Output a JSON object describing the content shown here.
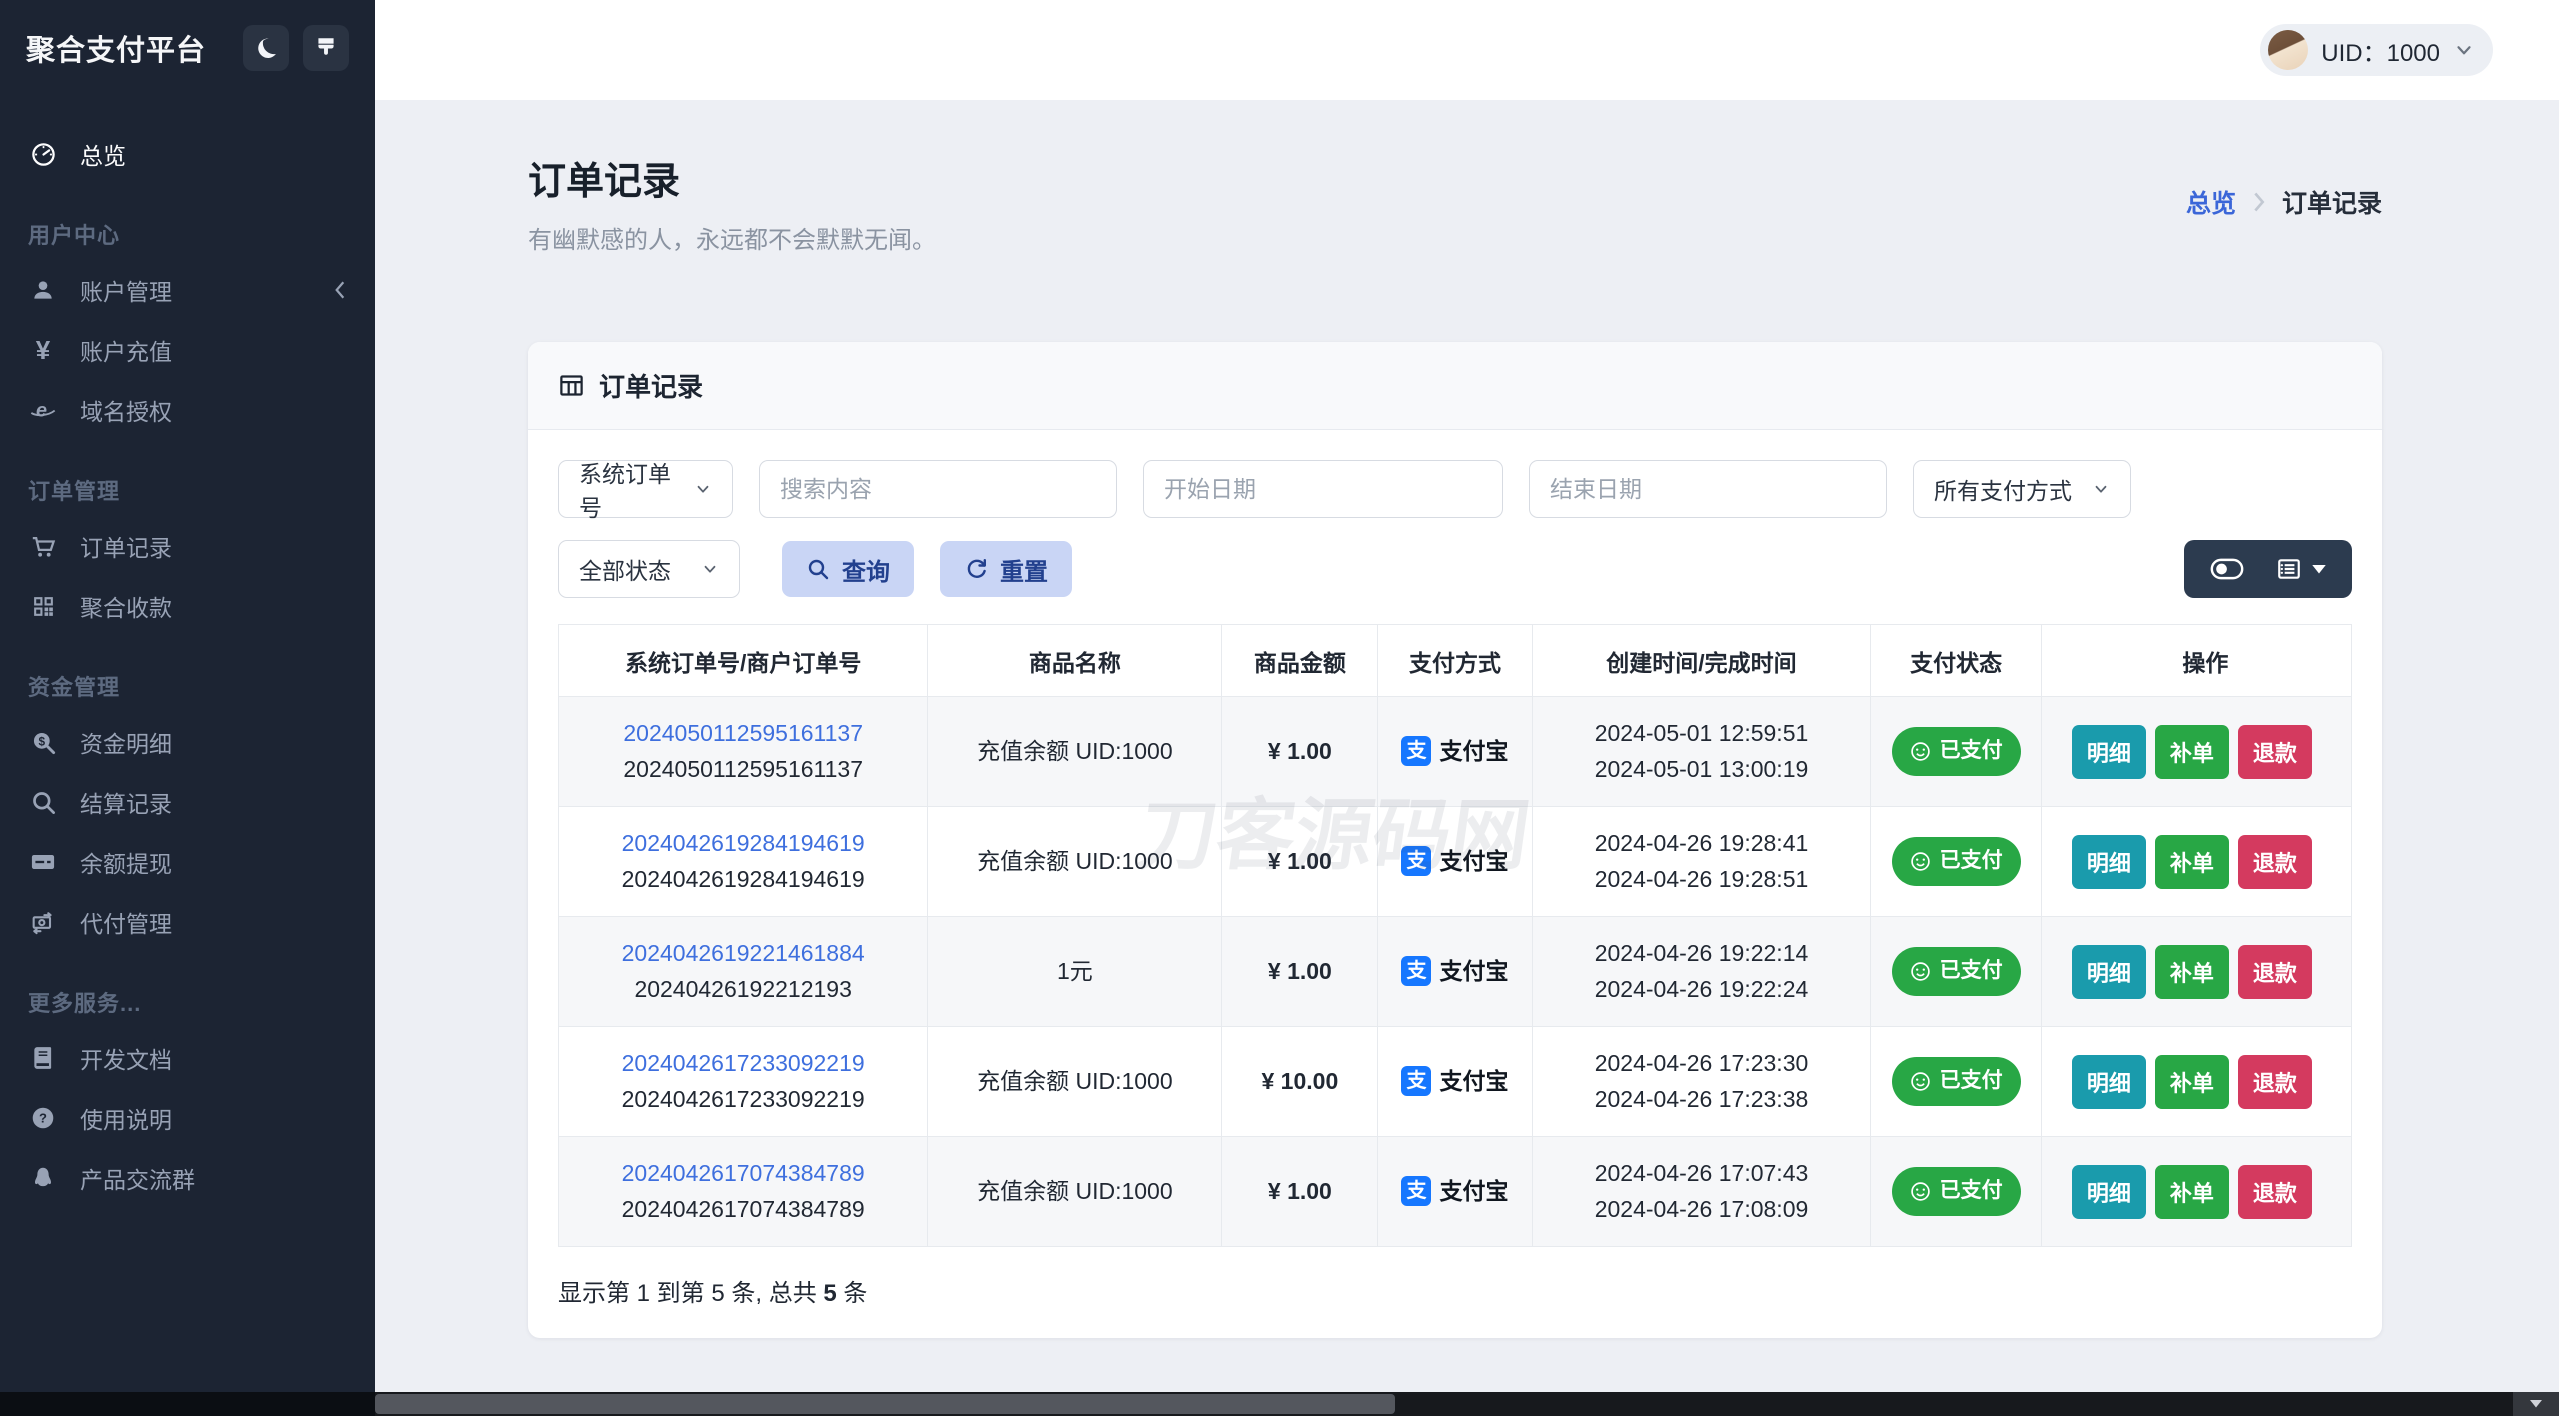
{
  "brand": {
    "title": "聚合支付平台"
  },
  "topbar": {
    "uid_text": "UID：1000"
  },
  "sidebar": {
    "overview_label": "总览",
    "section_user": "用户中心",
    "items_user": [
      "账户管理",
      "账户充值",
      "域名授权"
    ],
    "section_order": "订单管理",
    "items_order": [
      "订单记录",
      "聚合收款"
    ],
    "section_fund": "资金管理",
    "items_fund": [
      "资金明细",
      "结算记录",
      "余额提现",
      "代付管理"
    ],
    "section_more": "更多服务...",
    "items_more": [
      "开发文档",
      "使用说明",
      "产品交流群"
    ]
  },
  "page": {
    "title": "订单记录",
    "subtitle": "有幽默感的人，永远都不会默默无闻。",
    "breadcrumb": {
      "home": "总览",
      "current": "订单记录"
    }
  },
  "card": {
    "header": "订单记录"
  },
  "filters": {
    "order_type_value": "系统订单号",
    "search_placeholder": "搜索内容",
    "start_date_placeholder": "开始日期",
    "end_date_placeholder": "结束日期",
    "pay_method_value": "所有支付方式",
    "status_value": "全部状态",
    "query_label": "查询",
    "reset_label": "重置"
  },
  "icons": {
    "yen": "¥",
    "alipay_glyph": "支"
  },
  "table": {
    "columns": [
      "系统订单号/商户订单号",
      "商品名称",
      "商品金额",
      "支付方式",
      "创建时间/完成时间",
      "支付状态",
      "操作"
    ],
    "actions": {
      "detail": "明细",
      "reissue": "补单",
      "refund": "退款"
    },
    "rows": [
      {
        "sys_no": "2024050112595161137",
        "merchant_no": "2024050112595161137",
        "product": "充值余额 UID:1000",
        "amount": "¥ 1.00",
        "method": "支付宝",
        "created": "2024-05-01 12:59:51",
        "completed": "2024-05-01 13:00:19",
        "status": "已支付"
      },
      {
        "sys_no": "2024042619284194619",
        "merchant_no": "2024042619284194619",
        "product": "充值余额 UID:1000",
        "amount": "¥ 1.00",
        "method": "支付宝",
        "created": "2024-04-26 19:28:41",
        "completed": "2024-04-26 19:28:51",
        "status": "已支付"
      },
      {
        "sys_no": "2024042619221461884",
        "merchant_no": "20240426192212193",
        "product": "1元",
        "amount": "¥ 1.00",
        "method": "支付宝",
        "created": "2024-04-26 19:22:14",
        "completed": "2024-04-26 19:22:24",
        "status": "已支付"
      },
      {
        "sys_no": "2024042617233092219",
        "merchant_no": "2024042617233092219",
        "product": "充值余额 UID:1000",
        "amount": "¥ 10.00",
        "method": "支付宝",
        "created": "2024-04-26 17:23:30",
        "completed": "2024-04-26 17:23:38",
        "status": "已支付"
      },
      {
        "sys_no": "2024042617074384789",
        "merchant_no": "2024042617074384789",
        "product": "充值余额 UID:1000",
        "amount": "¥ 1.00",
        "method": "支付宝",
        "created": "2024-04-26 17:07:43",
        "completed": "2024-04-26 17:08:09",
        "status": "已支付"
      }
    ],
    "summary": {
      "prefix": "显示第 1 到第 5 条, 总共 ",
      "count": "5",
      "suffix": " 条"
    }
  },
  "watermark": "刀客源码网",
  "colors": {
    "sidebar_bg": "#1c2433",
    "accent_blue": "#3b66d8",
    "link_blue": "#3e6fde",
    "success_green": "#28a745",
    "info_teal": "#1a9bac",
    "danger_red": "#d43a5f",
    "alipay_blue": "#1677ff",
    "soft_button_bg": "#c9d5f5",
    "toolbar_navy": "#2c3b4f"
  }
}
